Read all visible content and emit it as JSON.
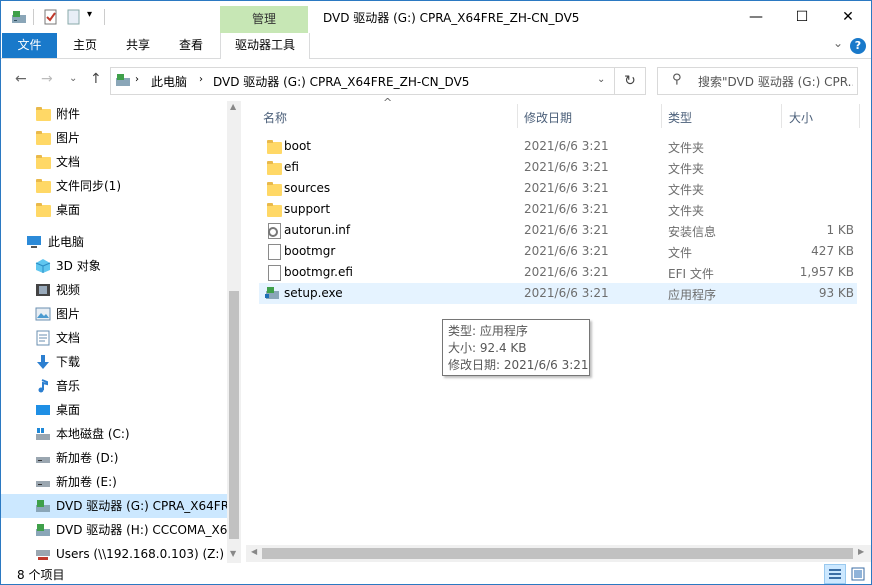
{
  "window": {
    "title": "DVD 驱动器 (G:) CPRA_X64FRE_ZH-CN_DV5",
    "context_tab_group": "管理",
    "minimize": "—",
    "maximize": "☐",
    "close": "✕"
  },
  "ribbon": {
    "tabs": [
      "文件",
      "主页",
      "共享",
      "查看",
      "驱动器工具"
    ],
    "collapse_glyph": "⌄",
    "help_glyph": "?"
  },
  "address": {
    "back_glyph": "←",
    "forward_glyph": "→",
    "recent_glyph": "⌄",
    "up_glyph": "↑",
    "segments": [
      "此电脑",
      "DVD 驱动器 (G:) CPRA_X64FRE_ZH-CN_DV5"
    ],
    "separator": "›",
    "dropdown_glyph": "⌄",
    "refresh_glyph": "↻",
    "search_placeholder": "搜索\"DVD 驱动器 (G:) CPR...",
    "search_glyph": "⚲"
  },
  "nav": {
    "quick_items": [
      "附件",
      "图片",
      "文档",
      "文件同步(1)",
      "桌面"
    ],
    "this_pc": "此电脑",
    "pc_items": [
      {
        "label": "3D 对象",
        "icon": "3d-objects-icon"
      },
      {
        "label": "视频",
        "icon": "video-icon"
      },
      {
        "label": "图片",
        "icon": "pictures-icon"
      },
      {
        "label": "文档",
        "icon": "documents-icon"
      },
      {
        "label": "下载",
        "icon": "download-icon"
      },
      {
        "label": "音乐",
        "icon": "music-icon"
      },
      {
        "label": "桌面",
        "icon": "desktop-icon"
      },
      {
        "label": "本地磁盘 (C:)",
        "icon": "local-disk-icon"
      },
      {
        "label": "新加卷 (D:)",
        "icon": "drive-icon"
      },
      {
        "label": "新加卷 (E:)",
        "icon": "drive-icon"
      },
      {
        "label": "DVD 驱动器 (G:) CPRA_X64FRE",
        "icon": "dvd-drive-icon",
        "selected": true
      },
      {
        "label": "DVD 驱动器 (H:) CCCOMA_X6",
        "icon": "dvd-drive-icon"
      },
      {
        "label": "Users (\\\\192.168.0.103) (Z:)",
        "icon": "network-drive-icon"
      }
    ]
  },
  "columns": {
    "name": "名称",
    "date": "修改日期",
    "type": "类型",
    "size": "大小",
    "sort_glyph": "^"
  },
  "files": [
    {
      "name": "boot",
      "date": "2021/6/6 3:21",
      "type": "文件夹",
      "size": "",
      "icon": "folder-icon"
    },
    {
      "name": "efi",
      "date": "2021/6/6 3:21",
      "type": "文件夹",
      "size": "",
      "icon": "folder-icon"
    },
    {
      "name": "sources",
      "date": "2021/6/6 3:21",
      "type": "文件夹",
      "size": "",
      "icon": "folder-icon"
    },
    {
      "name": "support",
      "date": "2021/6/6 3:21",
      "type": "文件夹",
      "size": "",
      "icon": "folder-icon"
    },
    {
      "name": "autorun.inf",
      "date": "2021/6/6 3:21",
      "type": "安装信息",
      "size": "1 KB",
      "icon": "settings-file-icon"
    },
    {
      "name": "bootmgr",
      "date": "2021/6/6 3:21",
      "type": "文件",
      "size": "427 KB",
      "icon": "file-icon"
    },
    {
      "name": "bootmgr.efi",
      "date": "2021/6/6 3:21",
      "type": "EFI 文件",
      "size": "1,957 KB",
      "icon": "file-icon"
    },
    {
      "name": "setup.exe",
      "date": "2021/6/6 3:21",
      "type": "应用程序",
      "size": "93 KB",
      "icon": "setup-exe-icon",
      "hovered": true
    }
  ],
  "tooltip": {
    "type_line": "类型: 应用程序",
    "size_line": "大小: 92.4 KB",
    "date_line": "修改日期: 2021/6/6 3:21"
  },
  "status": {
    "item_count": "8 个项目"
  },
  "colors": {
    "accent": "#1979ca",
    "context_tab": "#c7e7b5",
    "selected": "#cce8ff",
    "hover": "#e5f3ff"
  }
}
